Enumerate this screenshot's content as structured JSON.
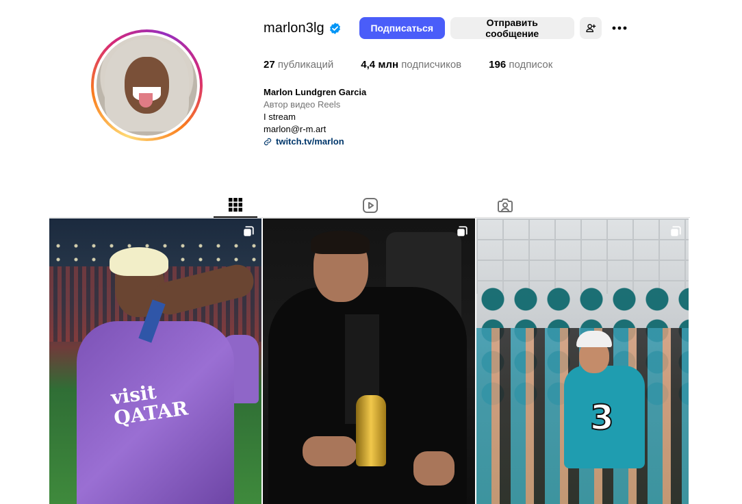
{
  "profile": {
    "username": "marlon3lg",
    "verified": true,
    "follow_label": "Подписаться",
    "message_label": "Отправить сообщение"
  },
  "stats": {
    "posts_count": "27",
    "posts_label": "публикаций",
    "followers_count": "4,4 млн",
    "followers_label": "подписчиков",
    "following_count": "196",
    "following_label": "подписок"
  },
  "bio": {
    "full_name": "Marlon Lundgren Garcia",
    "category": "Автор видео Reels",
    "line1": "I stream",
    "line2": "marlon@r-m.art",
    "link": "twitch.tv/marlon"
  },
  "tabs": [
    {
      "icon": "grid-icon",
      "active": true
    },
    {
      "icon": "reels-icon",
      "active": false
    },
    {
      "icon": "tagged-icon",
      "active": false
    }
  ],
  "posts": [
    {
      "type": "carousel",
      "overlay_text": "visit\nQATAR"
    },
    {
      "type": "carousel"
    },
    {
      "type": "carousel",
      "overlay_text": "3"
    }
  ],
  "colors": {
    "accent": "#4a5df9",
    "verified_badge": "#0095f6",
    "link": "#00376b",
    "secondary_text": "#737373",
    "secondary_button": "#efefef"
  }
}
